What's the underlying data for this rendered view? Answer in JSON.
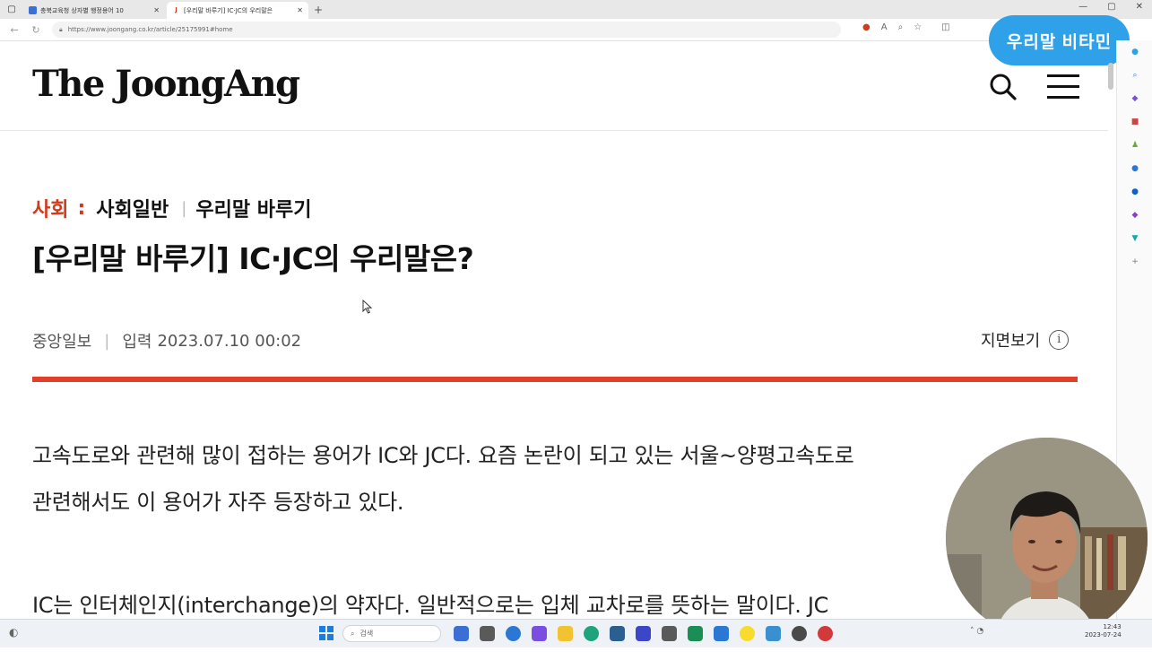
{
  "browser": {
    "tabs": [
      {
        "title": "충북교육청 상자별 행정용어 10",
        "favicon_color": "#3b6fd4",
        "active": false
      },
      {
        "title": "[우리말 바루기] IC·JC의 우리말은",
        "favicon_color": "#d23a1e",
        "active": true
      }
    ],
    "url": "https://www.joongang.co.kr/article/25175991#home"
  },
  "overlay": {
    "badge_label": "우리말 비타민",
    "badge_color": "#2ea1e8"
  },
  "site": {
    "logo": "The JoongAng",
    "accent_color": "#e0402a"
  },
  "article": {
    "section": "사회",
    "colon": ":",
    "subsection": "사회일반",
    "series": "우리말 바루기",
    "headline": "[우리말 바루기] IC·JC의 우리말은?",
    "publisher": "중앙일보",
    "date_label": "입력",
    "date": "2023.07.10 00:02",
    "paper_view": "지면보기",
    "paragraphs": [
      "고속도로와 관련해 많이 접하는 용어가 IC와 JC다. 요즘 논란이 되고 있는 서울~양평고속도로",
      "관련해서도 이 용어가 자주 등장하고 있다.",
      "IC는 인터체인지(interchange)의 약자다. 일반적으로는 입체 교차로를 뜻하는 말이다. JC"
    ]
  },
  "taskbar": {
    "search_placeholder": "검색",
    "time": "12:43",
    "date": "2023-07-24"
  }
}
